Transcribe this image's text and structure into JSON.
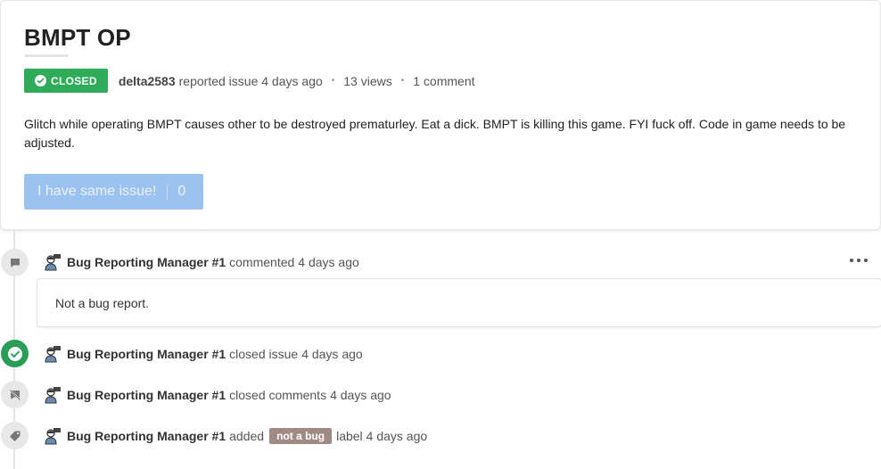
{
  "issue": {
    "title": "BMPT OP",
    "status": "CLOSED",
    "author": "delta2583",
    "reported_text": "reported issue 4 days ago",
    "views": "13 views",
    "comments": "1 comment",
    "body": "Glitch while operating BMPT causes other to be destroyed prematurley. Eat a dick. BMPT is killing this game. FYI fuck off. Code in game needs to be adjusted.",
    "same_issue_label": "I have same issue!",
    "same_issue_count": "0"
  },
  "timeline": [
    {
      "icon": "comment-icon",
      "actor": "Bug Reporting Manager #1",
      "action": "commented",
      "time": "4 days ago",
      "comment": "Not a bug report."
    },
    {
      "icon": "check-circle-icon",
      "actor": "Bug Reporting Manager #1",
      "action": "closed issue",
      "time": "4 days ago"
    },
    {
      "icon": "comments-off-icon",
      "actor": "Bug Reporting Manager #1",
      "action": "closed comments",
      "time": "4 days ago"
    },
    {
      "icon": "tag-icon",
      "actor": "Bug Reporting Manager #1",
      "action": "added",
      "label": "not a bug",
      "label_suffix": "label",
      "time": "4 days ago"
    }
  ],
  "colors": {
    "closed_badge": "#2fac5a",
    "button": "#9cc3ef",
    "label_tag": "#a08b84",
    "closed_icon": "#2a9d57"
  }
}
